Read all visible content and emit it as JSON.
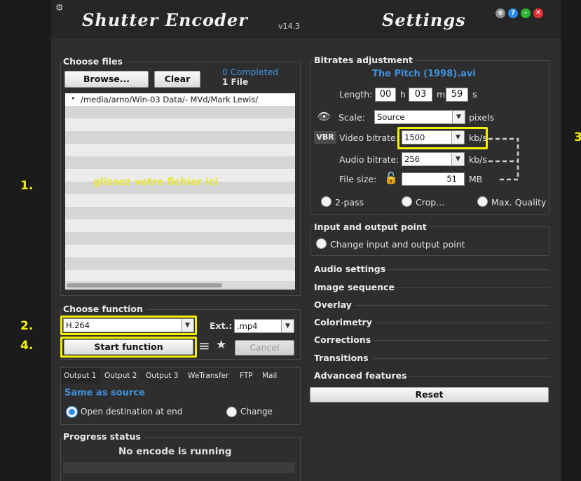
{
  "annotations": {
    "m1": "1.",
    "m2": "2.",
    "m3": "3",
    "m4": "4."
  },
  "titlebar": {
    "app_name": "Shutter Encoder",
    "version": "v14.3",
    "settings_title": "Settings",
    "help_label": "?"
  },
  "choose_files": {
    "title": "Choose files",
    "browse_label": "Browse...",
    "clear_label": "Clear",
    "completed": "0 Completed",
    "file_count": "1 File",
    "file_item": "/media/arno/Win-03 Data/- MVd/Mark Lewis/",
    "drop_hint": "glissez votre fichier ici"
  },
  "choose_function": {
    "title": "Choose function",
    "function_value": "H.264",
    "ext_label": "Ext.:",
    "ext_value": ".mp4",
    "start_label": "Start function",
    "cancel_label": "Cancel"
  },
  "output": {
    "tabs": [
      "Output 1",
      "Output 2",
      "Output 3",
      "WeTransfer",
      "FTP",
      "Mail"
    ],
    "destination": "Same as source",
    "open_dest_label": "Open destination at end",
    "change_label": "Change"
  },
  "progress": {
    "title": "Progress status",
    "status": "No encode is running"
  },
  "bitrates": {
    "title": "Bitrates adjustment",
    "filename": "The Pitch (1998).avi",
    "length_label": "Length:",
    "hours": "00",
    "h": "h",
    "minutes": "03",
    "m": "m",
    "seconds": "59",
    "s": "s",
    "scale_label": "Scale:",
    "scale_value": "Source",
    "pixels": "pixels",
    "vbr": "VBR",
    "video_bitrate_label": "Video bitrate:",
    "video_bitrate": "1500",
    "kbs": "kb/s",
    "audio_bitrate_label": "Audio bitrate:",
    "audio_bitrate": "256",
    "file_size_label": "File size:",
    "file_size": "51",
    "mb": "MB",
    "two_pass": "2-pass",
    "crop": "Crop...",
    "max_quality": "Max. Quality"
  },
  "io_point": {
    "title": "Input and output point",
    "change_label": "Change input and output point"
  },
  "sections": [
    "Audio settings",
    "Image sequence",
    "Overlay",
    "Colorimetry",
    "Corrections",
    "Transitions",
    "Advanced features"
  ],
  "reset_label": "Reset"
}
